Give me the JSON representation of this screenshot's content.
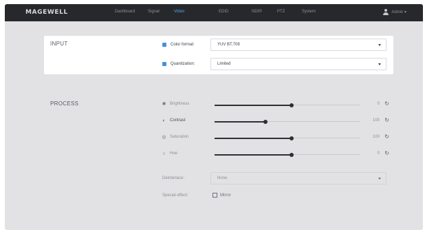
{
  "brand": {
    "logo": "MAGEWELL"
  },
  "nav": {
    "items": [
      {
        "label": "Dashboard",
        "active": false
      },
      {
        "label": "Signal",
        "active": false
      },
      {
        "label": "Video",
        "active": true
      },
      {
        "label": "EDID",
        "active": false
      },
      {
        "label": "NDI®",
        "active": false
      },
      {
        "label": "PTZ",
        "active": false
      },
      {
        "label": "System",
        "active": false
      }
    ],
    "user": {
      "icon": "user-icon",
      "name": "Admin ▾"
    }
  },
  "input": {
    "title": "INPUT",
    "color_format": {
      "label": "Color format:",
      "value": "YUV BT.709"
    },
    "quantization": {
      "label": "Quantization:",
      "value": "Limited"
    }
  },
  "process": {
    "title": "PROCESS",
    "sliders": [
      {
        "key": "brightness",
        "label": "Brightness",
        "icon": "sun-icon",
        "value": "0",
        "fraction": 0.53
      },
      {
        "key": "contrast",
        "label": "Contrast",
        "icon": "contrast-icon",
        "value": "100",
        "fraction": 0.35
      },
      {
        "key": "saturation",
        "label": "Saturation",
        "icon": "saturation-icon",
        "value": "100",
        "fraction": 0.53
      },
      {
        "key": "hue",
        "label": "Hue",
        "icon": "hue-icon",
        "value": "0",
        "fraction": 0.53
      }
    ],
    "deinterlace": {
      "label": "Deinterlace:",
      "value": "None"
    },
    "special_effect": {
      "label": "Special effect:",
      "option": "Mirror"
    }
  },
  "colors": {
    "accent": "#4aa6e8",
    "checkbox": "#4a90d9",
    "topbar": "#26282c",
    "panel": "#e2e2e4"
  }
}
